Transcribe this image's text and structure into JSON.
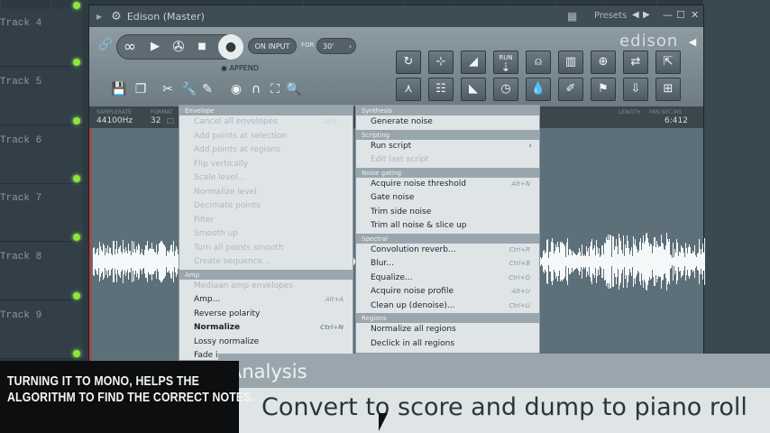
{
  "playlist": {
    "tracks": [
      "Track 4",
      "Track 5",
      "Track 6",
      "Track 7",
      "Track 8",
      "Track 9"
    ]
  },
  "window": {
    "title": "Edison (Master)",
    "presets_label": "Presets"
  },
  "toolbar": {
    "loop_icon": "∞",
    "on_input_label": "ON INPUT",
    "for_label": "FOR",
    "for_value": "30'",
    "append_label": "APPEND",
    "logo": "edison",
    "run_label": "RUN"
  },
  "infobar": {
    "samplerate_label": "SAMPLERATE",
    "samplerate_value": "44100Hz",
    "format_label": "FORMAT",
    "format_value": "32",
    "length_label": "LENGTH",
    "length_value": "MIN:SEC:MS",
    "time_value": "6:412"
  },
  "menu_left": {
    "sections": [
      {
        "title": "Envelope",
        "items": [
          {
            "label": "Cancel all envelopes",
            "shortcut": "Alt+...",
            "disabled": true
          },
          {
            "label": "Add points at selection",
            "shortcut": "",
            "disabled": true
          },
          {
            "label": "Add points at regions",
            "shortcut": "",
            "disabled": true
          },
          {
            "label": "Flip vertically",
            "shortcut": "",
            "disabled": true
          },
          {
            "label": "Scale level...",
            "shortcut": "",
            "disabled": true
          },
          {
            "label": "Normalize level",
            "shortcut": "",
            "disabled": true
          },
          {
            "label": "Decimate points",
            "shortcut": "",
            "disabled": true
          },
          {
            "label": "Filter",
            "shortcut": "",
            "disabled": true
          },
          {
            "label": "Smooth up",
            "shortcut": "",
            "disabled": true
          },
          {
            "label": "Turn all points smooth",
            "shortcut": "",
            "disabled": true
          },
          {
            "label": "Create sequence...",
            "shortcut": "",
            "disabled": true
          }
        ]
      },
      {
        "title": "Amp",
        "items": [
          {
            "label": "Mediaan amp envelopes",
            "shortcut": "",
            "disabled": true
          },
          {
            "label": "Amp...",
            "shortcut": "Alt+A",
            "disabled": false
          },
          {
            "label": "Reverse polarity",
            "shortcut": "",
            "disabled": false
          },
          {
            "label": "Normalize",
            "shortcut": "Ctrl+N",
            "disabled": false,
            "bold": true
          },
          {
            "label": "Lossy normalize",
            "shortcut": "",
            "disabled": false
          },
          {
            "label": "Fade i",
            "shortcut": "",
            "disabled": false
          }
        ]
      }
    ]
  },
  "menu_right": {
    "sections": [
      {
        "title": "Synthesis",
        "items": [
          {
            "label": "Generate noise",
            "shortcut": "",
            "disabled": false
          }
        ]
      },
      {
        "title": "Scripting",
        "items": [
          {
            "label": "Run script",
            "shortcut": "",
            "disabled": false,
            "submenu": "›"
          },
          {
            "label": "Edit last script",
            "shortcut": "",
            "disabled": true
          }
        ]
      },
      {
        "title": "Noise gating",
        "items": [
          {
            "label": "Acquire noise threshold",
            "shortcut": "Alt+N",
            "disabled": false
          },
          {
            "label": "Gate noise",
            "shortcut": "",
            "disabled": false
          },
          {
            "label": "Trim side noise",
            "shortcut": "",
            "disabled": false
          },
          {
            "label": "Trim all noise & slice up",
            "shortcut": "",
            "disabled": false
          }
        ]
      },
      {
        "title": "Spectral",
        "items": [
          {
            "label": "Convolution reverb...",
            "shortcut": "Ctrl+R",
            "disabled": false
          },
          {
            "label": "Blur...",
            "shortcut": "Ctrl+B",
            "disabled": false
          },
          {
            "label": "Equalize...",
            "shortcut": "Ctrl+Q",
            "disabled": false
          },
          {
            "label": "Acquire noise profile",
            "shortcut": "Alt+U",
            "disabled": false
          },
          {
            "label": "Clean up (denoise)...",
            "shortcut": "Ctrl+U",
            "disabled": false
          }
        ]
      },
      {
        "title": "Regions",
        "items": [
          {
            "label": "Normalize all regions",
            "shortcut": "",
            "disabled": false
          },
          {
            "label": "Declick in all regions",
            "shortcut": "",
            "disabled": false
          }
        ]
      }
    ]
  },
  "zoom": {
    "section": "Analysis",
    "item": "Convert to score and dump to piano roll"
  },
  "caption": {
    "line1": "TURNING IT TO MONO, HELPS THE",
    "line2": "ALGORITHM TO FIND THE CORRECT NOTES."
  },
  "colors": {
    "accent_green": "#8fe63a",
    "menu_bg": "#dfe4e7",
    "menu_section": "#9aa6ad"
  }
}
